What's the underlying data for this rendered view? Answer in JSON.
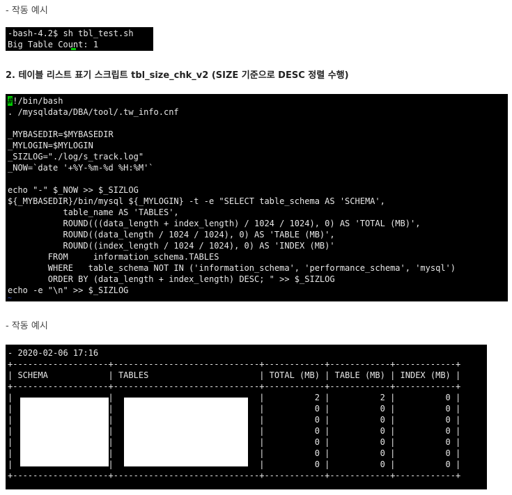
{
  "example_label_1": "- 작동 예시",
  "terminal1": {
    "lines": [
      "-bash-4.2$ sh tbl_test.sh",
      "Big Table Count: 1"
    ]
  },
  "section2_heading": "2. 테이블 리스트 표기 스크립트 tbl_size_chk_v2 (SIZE 기준으로 DESC 정렬 수행)",
  "script": {
    "shebang_hash": "#",
    "shebang_rest": "!/bin/bash",
    "lines": [
      ". /mysqldata/DBA/tool/.tw_info.cnf",
      "",
      "_MYBASEDIR=$MYBASEDIR",
      "_MYLOGIN=$MYLOGIN",
      "_SIZLOG=\"./log/s_track.log\"",
      "_NOW=`date '+%Y-%m-%d %H:%M'`",
      "",
      "echo \"-\" $_NOW >> $_SIZLOG",
      "${_MYBASEDIR}/bin/mysql ${_MYLOGIN} -t -e \"SELECT table_schema AS 'SCHEMA',",
      "           table_name AS 'TABLES',",
      "           ROUND(((data_length + index_length) / 1024 / 1024), 0) AS 'TOTAL (MB)',",
      "           ROUND((data_length / 1024 / 1024), 0) AS 'TABLE (MB)',",
      "           ROUND((index_length / 1024 / 1024), 0) AS 'INDEX (MB)'",
      "        FROM     information_schema.TABLES",
      "        WHERE   table_schema NOT IN ('information_schema', 'performance_schema', 'mysql')",
      "        ORDER BY (data_length + index_length) DESC; \" >> $_SIZLOG",
      "echo -e \"\\n\" >> $_SIZLOG"
    ],
    "tilde": "~"
  },
  "example_label_2": "- 작동 예시",
  "output": {
    "date_line": "- 2020-02-06 17:16",
    "border": "+-------------------+-----------------------------+------------+------------+------------+",
    "header": "| SCHEMA            | TABLES                      | TOTAL (MB) | TABLE (MB) | INDEX (MB) |",
    "rows": [
      "|                   |                             |          2 |          2 |          0 |",
      "|                   |                             |          0 |          0 |          0 |",
      "|                   |                             |          0 |          0 |          0 |",
      "|                   |                             |          0 |          0 |          0 |",
      "|                   |                             |          0 |          0 |          0 |",
      "|                   |                             |          0 |          0 |          0 |",
      "|                   |                             |          0 |          0 |          0 |"
    ]
  }
}
